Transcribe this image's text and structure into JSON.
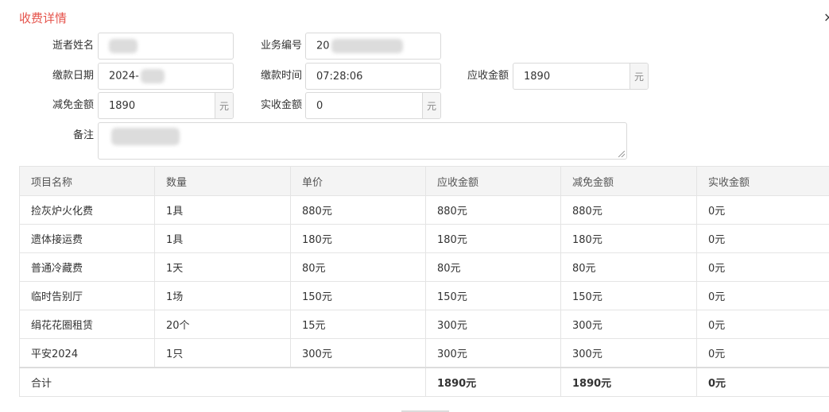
{
  "dialog": {
    "title": "收费详情",
    "close_glyph": "×"
  },
  "form": {
    "deceased_name": {
      "label": "逝者姓名",
      "value": ""
    },
    "business_no": {
      "label": "业务编号",
      "value": "20"
    },
    "pay_date": {
      "label": "缴款日期",
      "value": "2024-"
    },
    "pay_time": {
      "label": "缴款时间",
      "value": "07:28:06"
    },
    "receivable": {
      "label": "应收金额",
      "value": "1890",
      "unit": "元"
    },
    "waived": {
      "label": "减免金额",
      "value": "1890",
      "unit": "元"
    },
    "received": {
      "label": "实收金额",
      "value": "0",
      "unit": "元"
    },
    "remark": {
      "label": "备注",
      "value": ""
    }
  },
  "table": {
    "headers": [
      "项目名称",
      "数量",
      "单价",
      "应收金额",
      "减免金额",
      "实收金额"
    ],
    "rows": [
      [
        "捡灰炉火化费",
        "1具",
        "880元",
        "880元",
        "880元",
        "0元"
      ],
      [
        "遗体接运费",
        "1具",
        "180元",
        "180元",
        "180元",
        "0元"
      ],
      [
        "普通冷藏费",
        "1天",
        "80元",
        "80元",
        "80元",
        "0元"
      ],
      [
        "临时告别厅",
        "1场",
        "150元",
        "150元",
        "150元",
        "0元"
      ],
      [
        "绢花花圈租赁",
        "20个",
        "15元",
        "300元",
        "300元",
        "0元"
      ],
      [
        "平安2024",
        "1只",
        "300元",
        "300元",
        "300元",
        "0元"
      ]
    ],
    "total": {
      "label": "合计",
      "receivable": "1890元",
      "waived": "1890元",
      "received": "0元"
    }
  }
}
